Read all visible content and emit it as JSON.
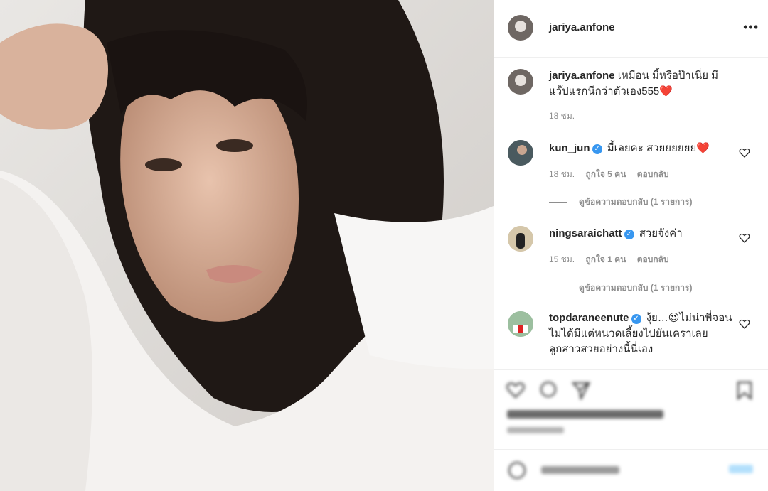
{
  "post": {
    "author": "jariya.anfone",
    "caption_user": "jariya.anfone",
    "caption_text": "เหมือน มี้หรือป๊าเนี่ย มีแว๊ปแรกนึกว่าตัวเอง555❤️",
    "caption_time": "18 ชม."
  },
  "comments": [
    {
      "user": "kun_jun",
      "verified": true,
      "text": "มี้เลยคะ สวยยยยยย❤️",
      "time": "18 ชม.",
      "likes": "ถูกใจ 5 คน",
      "reply_label": "ตอบกลับ",
      "view_replies": "ดูข้อความตอบกลับ (1 รายการ)"
    },
    {
      "user": "ningsaraichatt",
      "verified": true,
      "text": "สวยจังค่า",
      "time": "15 ชม.",
      "likes": "ถูกใจ 1 คน",
      "reply_label": "ตอบกลับ",
      "view_replies": "ดูข้อความตอบกลับ (1 รายการ)"
    },
    {
      "user": "topdaraneenute",
      "verified": true,
      "text": "งุ้ย…😍ไม่น่าพี่จอนไม่ได้มีแต่หนวดเลี้ยงไปยันเคราเลย ลูกสาวสวยอย่างนี้นี่เอง"
    }
  ],
  "colors": {
    "verified": "#3897f0",
    "heart": "#e3163b",
    "muted": "#8e8e8e"
  },
  "icons": {
    "more": "more-options-icon",
    "like": "heart-icon",
    "comment": "comment-icon",
    "share": "share-icon",
    "save": "bookmark-icon",
    "emoji": "emoji-icon"
  }
}
